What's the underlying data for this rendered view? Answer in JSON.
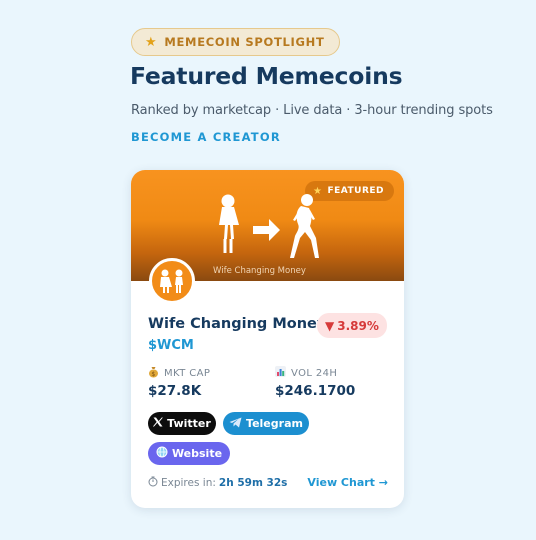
{
  "header": {
    "badge_label": "MEMECOIN SPOTLIGHT",
    "title": "Featured Memecoins",
    "subtitle": "Ranked by marketcap · Live data · 3-hour trending spots",
    "creator_link": "BECOME A CREATOR"
  },
  "card": {
    "featured_label": "FEATURED",
    "banner_caption": "Wife Changing Money",
    "name": "Wife Changing Money",
    "change": "3.89%",
    "change_arrow": "▼",
    "ticker": "$WCM",
    "market_cap_label": "MKT CAP",
    "market_cap_value": "$27.8K",
    "volume_label": "VOL 24H",
    "volume_value": "$246.1700",
    "buttons": {
      "twitter": "Twitter",
      "telegram": "Telegram",
      "website": "Website"
    },
    "expires_label": "Expires in:",
    "expires_value": "2h 59m 32s",
    "view_chart": "View Chart →"
  },
  "icons": {
    "badge": "star-icon",
    "featured": "star-icon",
    "market_cap": "money-bag-icon",
    "volume": "bar-chart-icon",
    "twitter": "x-logo-icon",
    "telegram": "paper-plane-icon",
    "website": "globe-icon",
    "expires": "stopwatch-icon"
  },
  "colors": {
    "background": "#eaf6fd",
    "accent": "#1f97d3",
    "title": "#163a5f",
    "banner": "#f8931f",
    "negative": "#d63a3a",
    "twitter": "#0d0d0d",
    "telegram": "#1c8fd0",
    "website": "#6a66ee"
  }
}
